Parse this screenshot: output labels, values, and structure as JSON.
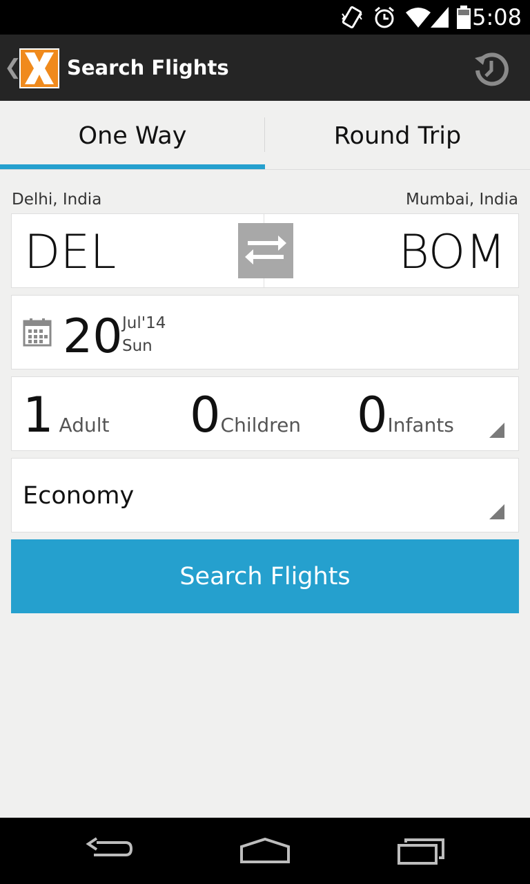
{
  "status_bar": {
    "time": "5:08",
    "icons": [
      "vibrate-icon",
      "alarm-icon",
      "wifi-icon",
      "signal-icon",
      "battery-icon"
    ]
  },
  "action_bar": {
    "title": "Search Flights",
    "logo": "x-logo",
    "history_icon": "history-icon",
    "colors": {
      "background": "#252525",
      "logo_orange": "#f08a1c"
    }
  },
  "tabs": [
    {
      "label": "One Way",
      "selected": true
    },
    {
      "label": "Round Trip",
      "selected": false
    }
  ],
  "route": {
    "from_city": "Delhi, India",
    "from_code": "DEL",
    "to_city": "Mumbai, India",
    "to_code": "BOM",
    "swap_icon": "swap-arrows-icon"
  },
  "date": {
    "day": "20",
    "month_year": "Jul'14",
    "weekday": "Sun",
    "icon": "calendar-icon"
  },
  "passengers": {
    "adults": {
      "count": "1",
      "label": "Adult"
    },
    "children": {
      "count": "0",
      "label": "Children"
    },
    "infants": {
      "count": "0",
      "label": "Infants"
    }
  },
  "cabin_class": {
    "value": "Economy"
  },
  "search_button": {
    "label": "Search Flights"
  },
  "accent_color": "#25a0ce",
  "nav_bar": {
    "icons": [
      "back-icon",
      "home-icon",
      "recents-icon"
    ]
  }
}
